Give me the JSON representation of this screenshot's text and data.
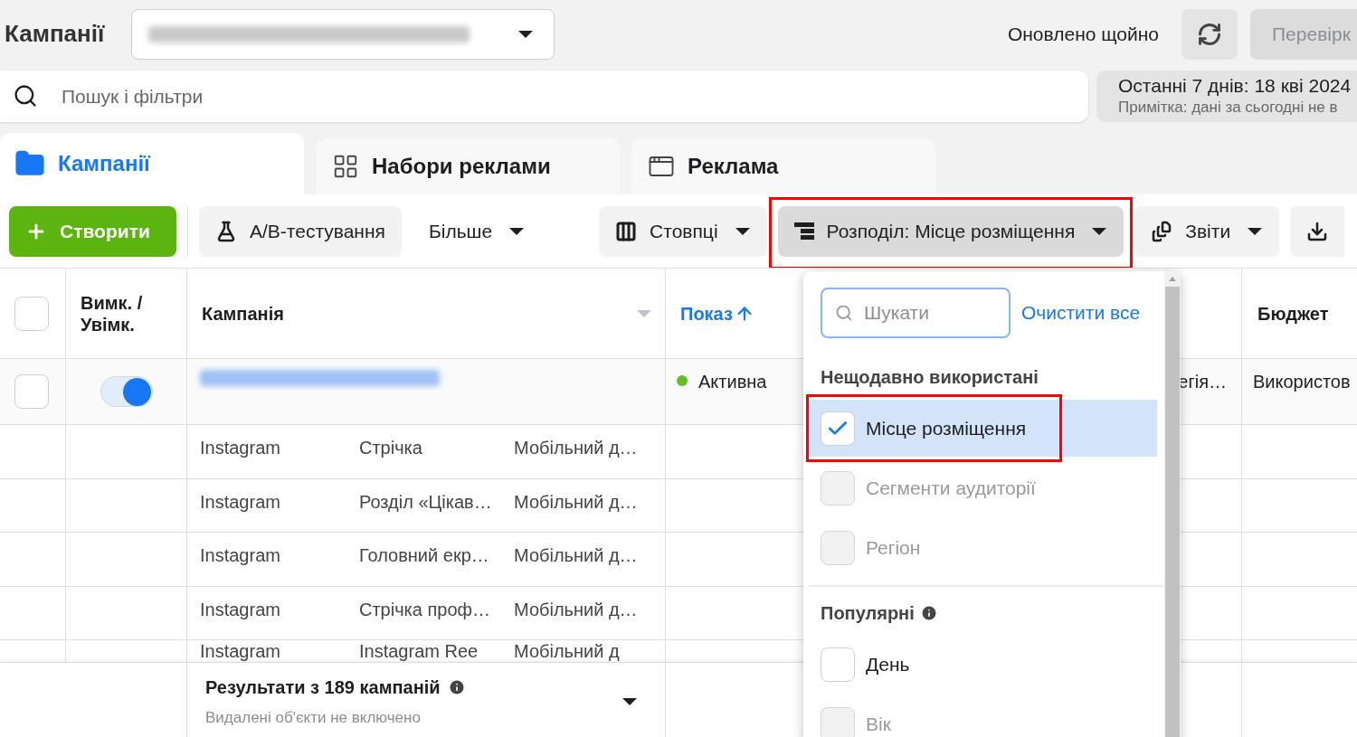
{
  "header": {
    "title": "Кампанії",
    "updated": "Оновлено щойно",
    "review_button": "Перевірк"
  },
  "search": {
    "placeholder": "Пошук і фільтри"
  },
  "date_range": {
    "label": "Останні 7 днів: 18 кві 2024",
    "note": "Примітка: дані за сьогодні не в"
  },
  "tabs": [
    {
      "label": "Кампанії",
      "kind": "campaigns",
      "selected": true
    },
    {
      "label": "Набори реклами",
      "kind": "adsets",
      "selected": false
    },
    {
      "label": "Реклама",
      "kind": "ads",
      "selected": false
    }
  ],
  "toolbar": {
    "create": "Створити",
    "buttons": [
      {
        "label": "A/B-тестування",
        "kind": "flask",
        "highlighted": false
      },
      {
        "label": "Більше",
        "kind": "menu",
        "highlighted": false
      },
      {
        "label": "Стовпці",
        "kind": "columns",
        "highlighted": false
      },
      {
        "label": "Розподіл: Місце розміщення",
        "kind": "breakdown",
        "highlighted": true
      },
      {
        "label": "Звіти",
        "kind": "reports",
        "highlighted": false
      }
    ]
  },
  "table": {
    "header_checked": false,
    "columns": [
      {
        "label": "Вимк. / Увімк."
      },
      {
        "label": "Кампанія"
      },
      {
        "label": "Показ",
        "sorted": true
      },
      {
        "label": "Бюджет"
      }
    ],
    "campaign_row": {
      "checked": false,
      "on": true,
      "status": "Активна",
      "color": "#63be25",
      "column_5": "егія…",
      "budget": "Використов"
    },
    "breakdown_rows": [
      {
        "platform": "Instagram",
        "placement": "Стрічка",
        "device": "Мобільний д…"
      },
      {
        "platform": "Instagram",
        "placement": "Розділ «Цікав…",
        "device": "Мобільний д…"
      },
      {
        "platform": "Instagram",
        "placement": "Головний екр…",
        "device": "Мобільний д…"
      },
      {
        "platform": "Instagram",
        "placement": "Стрічка проф…",
        "device": "Мобільний д…"
      },
      {
        "platform": "Instagram",
        "placement": "Instagram Ree",
        "device": "Мобільний д"
      }
    ],
    "footer": {
      "title": "Результати з 189 кампаній",
      "subtitle": "Видалені об'єкти не включено"
    }
  },
  "breakdown_menu": {
    "search_placeholder": "Шукати",
    "clear_all": "Очистити все",
    "sections": [
      {
        "title": "Нещодавно використані",
        "items": [
          {
            "label": "Місце розміщення",
            "checked": true,
            "disabled": false,
            "highlighted": true
          },
          {
            "label": "Сегменти аудиторії",
            "checked": false,
            "disabled": true,
            "highlighted": false
          },
          {
            "label": "Регіон",
            "checked": false,
            "disabled": true,
            "highlighted": false
          }
        ]
      },
      {
        "title": "Популярні",
        "info": true,
        "items": [
          {
            "label": "День",
            "checked": false,
            "disabled": false,
            "highlighted": false
          },
          {
            "label": "Вік",
            "checked": false,
            "disabled": true,
            "highlighted": false
          }
        ]
      }
    ]
  }
}
